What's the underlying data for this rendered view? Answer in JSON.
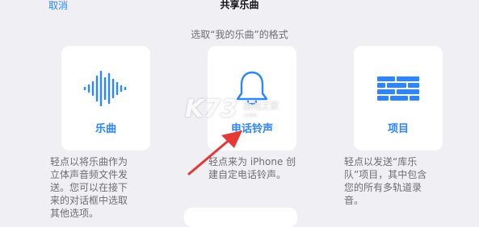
{
  "nav": {
    "cancel_label": "取消",
    "title": "共享乐曲"
  },
  "subtitle": "选取“我的乐曲”的格式",
  "options": [
    {
      "label": "乐曲",
      "icon": "waveform-icon",
      "description": "轻点以将乐曲作为\n立体声音频文件发\n送。您可以在接下\n来的对话框中选取\n其他选项。"
    },
    {
      "label": "电话铃声",
      "icon": "bell-icon",
      "description": "轻点来为 iPhone 创\n建自定电话铃声。"
    },
    {
      "label": "项目",
      "icon": "brick-wall-icon",
      "description": "轻点以发送“库乐\n队”项目，其中包含\n您的所有多轨道录\n音。"
    }
  ],
  "watermark": {
    "logo": "K73",
    "text": "游戏之家",
    "url": ".com"
  },
  "colors": {
    "accent": "#2d86ff",
    "background": "#efeff4",
    "card": "#ffffff",
    "secondary_text": "#6d6d72",
    "arrow": "#e53935"
  }
}
